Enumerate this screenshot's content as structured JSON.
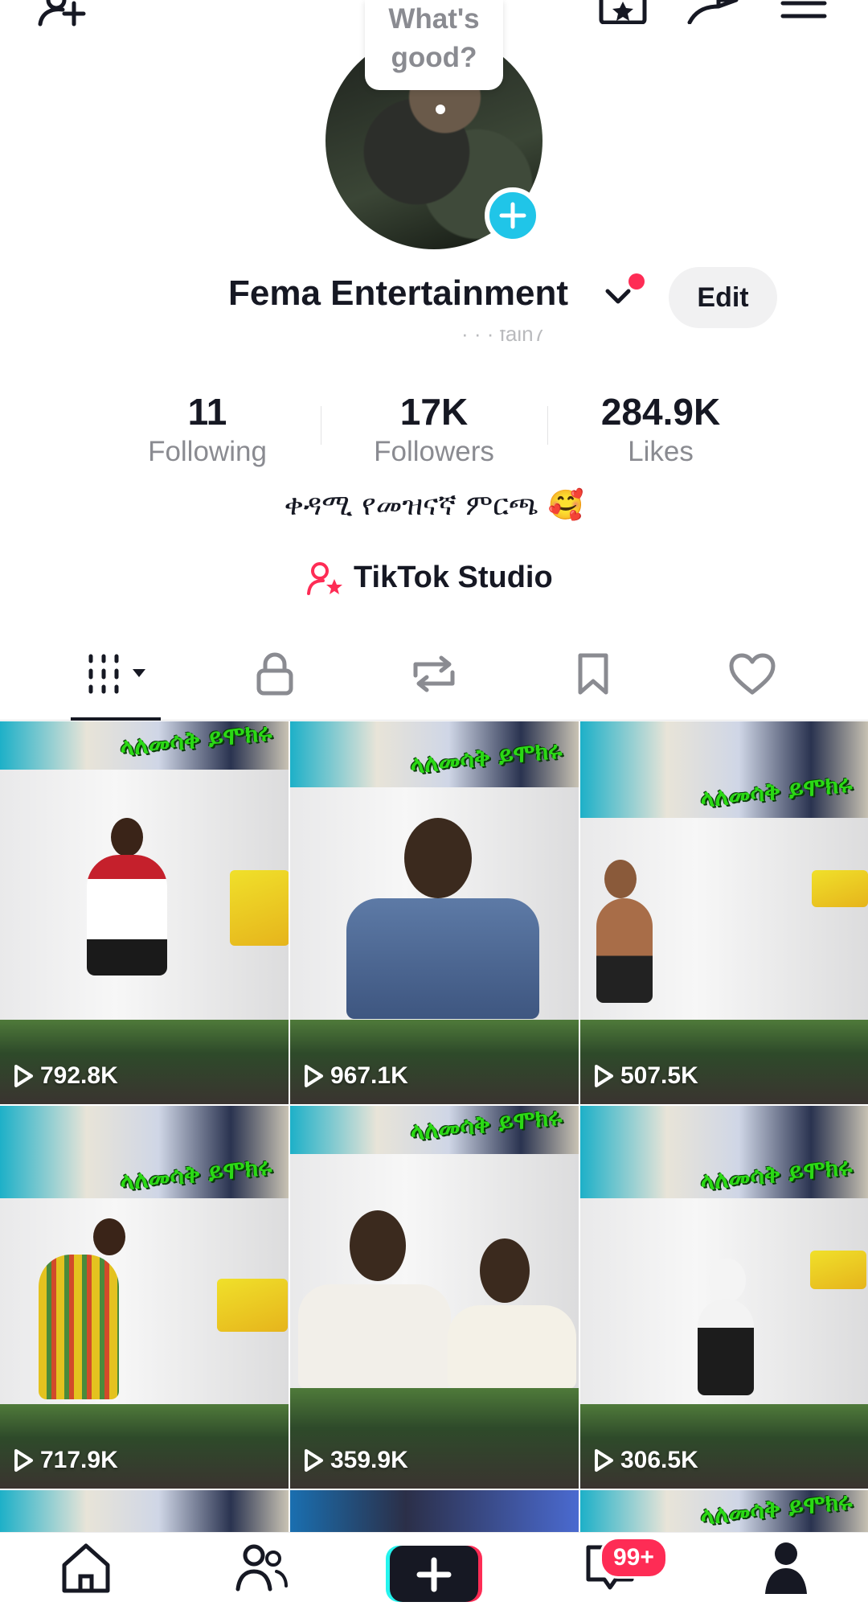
{
  "top_bar": {
    "icons": [
      "add-friend-icon",
      "favorites-icon",
      "share-icon",
      "menu-icon"
    ]
  },
  "profile": {
    "note": "What's good?",
    "display_name": "Fema Entertainment",
    "username_partial": "· · · fain7",
    "edit_label": "Edit",
    "stats": [
      {
        "value": "11",
        "label": "Following"
      },
      {
        "value": "17K",
        "label": "Followers"
      },
      {
        "value": "284.9K",
        "label": "Likes"
      }
    ],
    "bio": "ቀዳሚ የመዝናኛ ምርጫ 🥰",
    "studio_label": "TikTok Studio"
  },
  "tabs": [
    "videos",
    "private",
    "reposts",
    "saved",
    "liked"
  ],
  "videos": [
    {
      "views": "792.8K",
      "banner": "ላለመሳቅ ይሞክሩ"
    },
    {
      "views": "967.1K",
      "banner": "ላለመሳቅ ይሞክሩ"
    },
    {
      "views": "507.5K",
      "banner": "ላለመሳቅ ይሞክሩ"
    },
    {
      "views": "717.9K",
      "banner": "ላለመሳቅ ይሞክሩ"
    },
    {
      "views": "359.9K",
      "banner": "ላለመሳቅ ይሞክሩ"
    },
    {
      "views": "306.5K",
      "banner": "ላለመሳቅ ይሞክሩ"
    },
    {
      "views": "",
      "banner": ""
    },
    {
      "views": "",
      "banner": ""
    },
    {
      "views": "",
      "banner": "ላለመሳቅ ይሞክሩ"
    }
  ],
  "bottom_nav": {
    "inbox_badge": "99+"
  },
  "colors": {
    "accent": "#fe2c55",
    "cyan": "#20c5e8",
    "text": "#161823",
    "secondary": "#8a8b91"
  }
}
